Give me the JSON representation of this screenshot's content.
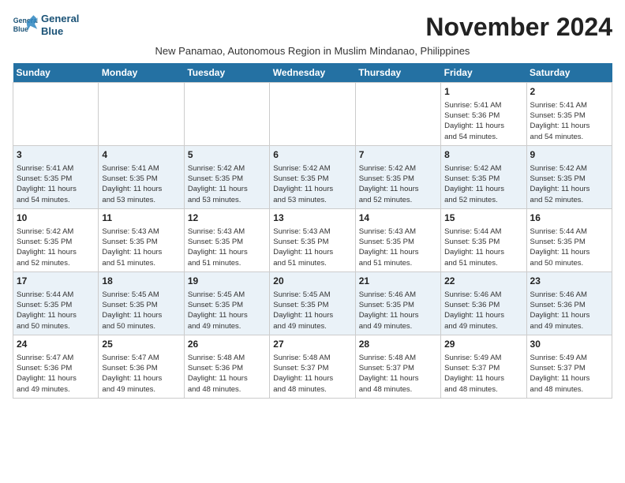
{
  "app": {
    "name": "GeneralBlue",
    "logo_line1": "General",
    "logo_line2": "Blue"
  },
  "calendar": {
    "month_title": "November 2024",
    "subtitle": "New Panamao, Autonomous Region in Muslim Mindanao, Philippines",
    "headers": [
      "Sunday",
      "Monday",
      "Tuesday",
      "Wednesday",
      "Thursday",
      "Friday",
      "Saturday"
    ],
    "weeks": [
      [
        {
          "day": "",
          "info": ""
        },
        {
          "day": "",
          "info": ""
        },
        {
          "day": "",
          "info": ""
        },
        {
          "day": "",
          "info": ""
        },
        {
          "day": "",
          "info": ""
        },
        {
          "day": "1",
          "info": "Sunrise: 5:41 AM\nSunset: 5:36 PM\nDaylight: 11 hours\nand 54 minutes."
        },
        {
          "day": "2",
          "info": "Sunrise: 5:41 AM\nSunset: 5:35 PM\nDaylight: 11 hours\nand 54 minutes."
        }
      ],
      [
        {
          "day": "3",
          "info": "Sunrise: 5:41 AM\nSunset: 5:35 PM\nDaylight: 11 hours\nand 54 minutes."
        },
        {
          "day": "4",
          "info": "Sunrise: 5:41 AM\nSunset: 5:35 PM\nDaylight: 11 hours\nand 53 minutes."
        },
        {
          "day": "5",
          "info": "Sunrise: 5:42 AM\nSunset: 5:35 PM\nDaylight: 11 hours\nand 53 minutes."
        },
        {
          "day": "6",
          "info": "Sunrise: 5:42 AM\nSunset: 5:35 PM\nDaylight: 11 hours\nand 53 minutes."
        },
        {
          "day": "7",
          "info": "Sunrise: 5:42 AM\nSunset: 5:35 PM\nDaylight: 11 hours\nand 52 minutes."
        },
        {
          "day": "8",
          "info": "Sunrise: 5:42 AM\nSunset: 5:35 PM\nDaylight: 11 hours\nand 52 minutes."
        },
        {
          "day": "9",
          "info": "Sunrise: 5:42 AM\nSunset: 5:35 PM\nDaylight: 11 hours\nand 52 minutes."
        }
      ],
      [
        {
          "day": "10",
          "info": "Sunrise: 5:42 AM\nSunset: 5:35 PM\nDaylight: 11 hours\nand 52 minutes."
        },
        {
          "day": "11",
          "info": "Sunrise: 5:43 AM\nSunset: 5:35 PM\nDaylight: 11 hours\nand 51 minutes."
        },
        {
          "day": "12",
          "info": "Sunrise: 5:43 AM\nSunset: 5:35 PM\nDaylight: 11 hours\nand 51 minutes."
        },
        {
          "day": "13",
          "info": "Sunrise: 5:43 AM\nSunset: 5:35 PM\nDaylight: 11 hours\nand 51 minutes."
        },
        {
          "day": "14",
          "info": "Sunrise: 5:43 AM\nSunset: 5:35 PM\nDaylight: 11 hours\nand 51 minutes."
        },
        {
          "day": "15",
          "info": "Sunrise: 5:44 AM\nSunset: 5:35 PM\nDaylight: 11 hours\nand 51 minutes."
        },
        {
          "day": "16",
          "info": "Sunrise: 5:44 AM\nSunset: 5:35 PM\nDaylight: 11 hours\nand 50 minutes."
        }
      ],
      [
        {
          "day": "17",
          "info": "Sunrise: 5:44 AM\nSunset: 5:35 PM\nDaylight: 11 hours\nand 50 minutes."
        },
        {
          "day": "18",
          "info": "Sunrise: 5:45 AM\nSunset: 5:35 PM\nDaylight: 11 hours\nand 50 minutes."
        },
        {
          "day": "19",
          "info": "Sunrise: 5:45 AM\nSunset: 5:35 PM\nDaylight: 11 hours\nand 49 minutes."
        },
        {
          "day": "20",
          "info": "Sunrise: 5:45 AM\nSunset: 5:35 PM\nDaylight: 11 hours\nand 49 minutes."
        },
        {
          "day": "21",
          "info": "Sunrise: 5:46 AM\nSunset: 5:35 PM\nDaylight: 11 hours\nand 49 minutes."
        },
        {
          "day": "22",
          "info": "Sunrise: 5:46 AM\nSunset: 5:36 PM\nDaylight: 11 hours\nand 49 minutes."
        },
        {
          "day": "23",
          "info": "Sunrise: 5:46 AM\nSunset: 5:36 PM\nDaylight: 11 hours\nand 49 minutes."
        }
      ],
      [
        {
          "day": "24",
          "info": "Sunrise: 5:47 AM\nSunset: 5:36 PM\nDaylight: 11 hours\nand 49 minutes."
        },
        {
          "day": "25",
          "info": "Sunrise: 5:47 AM\nSunset: 5:36 PM\nDaylight: 11 hours\nand 49 minutes."
        },
        {
          "day": "26",
          "info": "Sunrise: 5:48 AM\nSunset: 5:36 PM\nDaylight: 11 hours\nand 48 minutes."
        },
        {
          "day": "27",
          "info": "Sunrise: 5:48 AM\nSunset: 5:37 PM\nDaylight: 11 hours\nand 48 minutes."
        },
        {
          "day": "28",
          "info": "Sunrise: 5:48 AM\nSunset: 5:37 PM\nDaylight: 11 hours\nand 48 minutes."
        },
        {
          "day": "29",
          "info": "Sunrise: 5:49 AM\nSunset: 5:37 PM\nDaylight: 11 hours\nand 48 minutes."
        },
        {
          "day": "30",
          "info": "Sunrise: 5:49 AM\nSunset: 5:37 PM\nDaylight: 11 hours\nand 48 minutes."
        }
      ]
    ]
  }
}
